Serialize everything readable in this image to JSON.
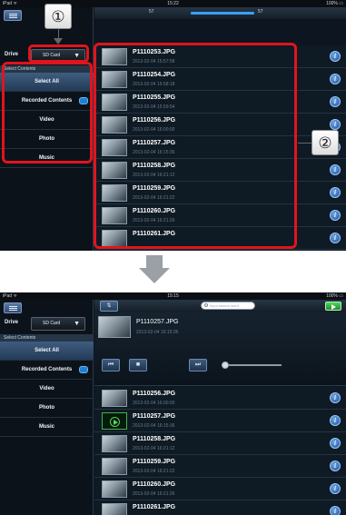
{
  "callouts": [
    "①",
    "②"
  ],
  "top": {
    "status": {
      "left": "iPad ᯤ",
      "time": "15:22",
      "battery": "100% ▭"
    },
    "progress": {
      "current": "57",
      "total": "57",
      "fraction": 1.0
    },
    "sidebar": {
      "drive_label": "Drive",
      "drive_value": "SD Card",
      "select_contents": "Select Contents",
      "items": [
        "Select All",
        "Recorded Contents",
        "Video",
        "Photo",
        "Music"
      ]
    },
    "files": [
      {
        "name": "P1110253.JPG",
        "date": "2013-02-04 15:57:58"
      },
      {
        "name": "P1110254.JPG",
        "date": "2013-02-04 15:58:18"
      },
      {
        "name": "P1110255.JPG",
        "date": "2013-02-04 15:59:54"
      },
      {
        "name": "P1110256.JPG",
        "date": "2013-02-04 16:00:00"
      },
      {
        "name": "P1110257.JPG",
        "date": "2013-02-04 16:15:36"
      },
      {
        "name": "P1110258.JPG",
        "date": "2013-02-04 16:21:12"
      },
      {
        "name": "P1110259.JPG",
        "date": "2013-02-04 16:21:22"
      },
      {
        "name": "P1110260.JPG",
        "date": "2013-02-04 16:21:26"
      },
      {
        "name": "P1110261.JPG",
        "date": ""
      }
    ]
  },
  "bottom": {
    "status": {
      "left": "iPad ᯤ",
      "time": "15:15",
      "battery": "100% ▭"
    },
    "search_placeholder": "Input search word",
    "sidebar": {
      "drive_label": "Drive",
      "drive_value": "SD Card",
      "select_contents": "Select Contents",
      "items": [
        "Select All",
        "Recorded Contents",
        "Video",
        "Photo",
        "Music"
      ]
    },
    "player": {
      "name": "P1110257.JPG",
      "date": "2013-02-04 16:15:36"
    },
    "files": [
      {
        "name": "P1110256.JPG",
        "date": "2013-02-04 16:00:00"
      },
      {
        "name": "P1110257.JPG",
        "date": "2013-02-04 16:15:36"
      },
      {
        "name": "P1110258.JPG",
        "date": "2013-02-04 16:21:12"
      },
      {
        "name": "P1110259.JPG",
        "date": "2013-02-04 16:21:22"
      },
      {
        "name": "P1110260.JPG",
        "date": "2013-02-04 16:21:26"
      },
      {
        "name": "P1110261.JPG",
        "date": ""
      }
    ]
  },
  "colors": {
    "highlight": "#e0141d",
    "accent": "#3aa0ff",
    "play": "#4fd860"
  }
}
